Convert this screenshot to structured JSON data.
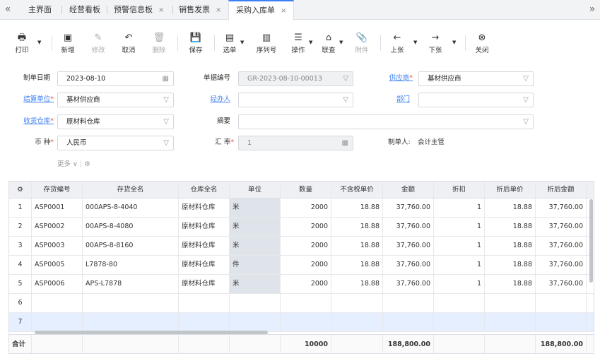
{
  "tabs": {
    "back_arrow": "«",
    "forward_arrow": "»",
    "items": [
      {
        "label": "主界面",
        "closable": false
      },
      {
        "label": "经营看板",
        "closable": false
      },
      {
        "label": "预警信息板",
        "closable": true
      },
      {
        "label": "销售发票",
        "closable": true
      },
      {
        "label": "采购入库单",
        "closable": true,
        "active": true
      }
    ],
    "close_glyph": "×"
  },
  "toolbar": {
    "print": "打印",
    "new": "新增",
    "edit": "修改",
    "cancel": "取消",
    "delete": "删除",
    "save": "保存",
    "select": "选单",
    "serial": "序列号",
    "operate": "操作",
    "query": "联查",
    "attach": "附件",
    "prev": "上张",
    "next": "下张",
    "close": "关闭"
  },
  "form": {
    "date_label": "制单日期",
    "date_value": "2023-08-10",
    "docno_label": "单据编号",
    "docno_value": "GR-2023-08-10-00013",
    "supplier_label": "供应商",
    "supplier_value": "基材供应商",
    "settle_label": "结算单位",
    "settle_value": "基材供应商",
    "handler_label": "经办人",
    "handler_value": "",
    "dept_label": "部门",
    "dept_value": "",
    "warehouse_label": "收货仓库",
    "warehouse_value": "原材料仓库",
    "summary_label": "摘要",
    "summary_value": "",
    "currency_label": "币 种",
    "currency_value": "人民币",
    "rate_label": "汇 率",
    "rate_value": "1",
    "creator_label": "制单人:",
    "creator_value": "会计主管",
    "more": "更多",
    "required_mark": "*"
  },
  "grid": {
    "headers": [
      "存货编号",
      "存货全名",
      "仓库全名",
      "单位",
      "数量",
      "不含税单价",
      "金额",
      "折扣",
      "折后单价",
      "折后金额"
    ],
    "rows": [
      {
        "no": "1",
        "code": "ASP0001",
        "name": "000APS-8-4040",
        "wh": "原材料仓库",
        "unit": "米",
        "qty": "2000",
        "price": "18.88",
        "amount": "37,760.00",
        "disc": "1",
        "dprice": "18.88",
        "damount": "37,760.00"
      },
      {
        "no": "2",
        "code": "ASP0002",
        "name": "00APS-8-4080",
        "wh": "原材料仓库",
        "unit": "米",
        "qty": "2000",
        "price": "18.88",
        "amount": "37,760.00",
        "disc": "1",
        "dprice": "18.88",
        "damount": "37,760.00"
      },
      {
        "no": "3",
        "code": "ASP0003",
        "name": "00APS-8-8160",
        "wh": "原材料仓库",
        "unit": "米",
        "qty": "2000",
        "price": "18.88",
        "amount": "37,760.00",
        "disc": "1",
        "dprice": "18.88",
        "damount": "37,760.00"
      },
      {
        "no": "4",
        "code": "ASP0005",
        "name": "L7878-80",
        "wh": "原材料仓库",
        "unit": "件",
        "qty": "2000",
        "price": "18.88",
        "amount": "37,760.00",
        "disc": "1",
        "dprice": "18.88",
        "damount": "37,760.00"
      },
      {
        "no": "5",
        "code": "ASP0006",
        "name": "APS-L7878",
        "wh": "原材料仓库",
        "unit": "米",
        "qty": "2000",
        "price": "18.88",
        "amount": "37,760.00",
        "disc": "1",
        "dprice": "18.88",
        "damount": "37,760.00"
      },
      {
        "no": "6",
        "code": "",
        "name": "",
        "wh": "",
        "unit": "",
        "qty": "",
        "price": "",
        "amount": "",
        "disc": "",
        "dprice": "",
        "damount": ""
      },
      {
        "no": "7",
        "code": "",
        "name": "",
        "wh": "",
        "unit": "",
        "qty": "",
        "price": "",
        "amount": "",
        "disc": "",
        "dprice": "",
        "damount": ""
      }
    ],
    "footer": {
      "label": "合计",
      "qty": "10000",
      "amount": "188,800.00",
      "damount": "188,800.00"
    }
  },
  "colors": {
    "accent": "#3d7ff5",
    "required": "#e74c3c"
  }
}
